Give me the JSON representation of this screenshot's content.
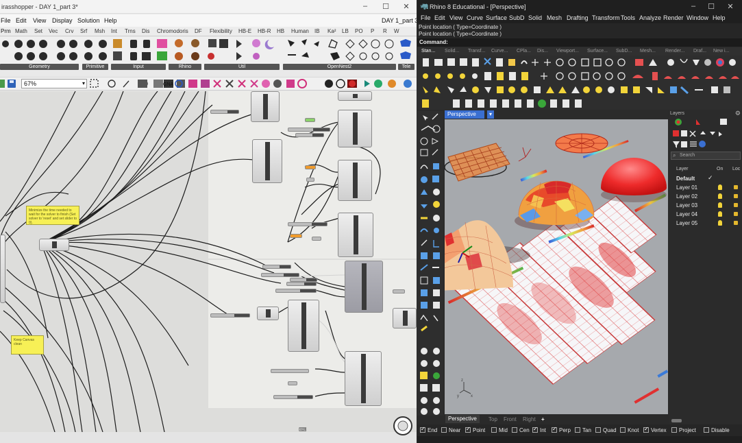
{
  "grasshopper": {
    "title": "irasshopper - DAY 1_part 3*",
    "doc_title": "DAY 1_part 3",
    "menu": [
      "File",
      "Edit",
      "View",
      "Display",
      "Solution",
      "Help"
    ],
    "tabs": [
      "Prm",
      "Math",
      "Set",
      "Vec",
      "Crv",
      "Srf",
      "Msh",
      "Int",
      "Trns",
      "Dis",
      "Chromodoris",
      "DF",
      "Flexibility",
      "HB-E",
      "HB-R",
      "HB",
      "Human",
      "IB",
      "Ka²",
      "LB",
      "PO",
      "P",
      "R",
      "W"
    ],
    "active_tab": "Prm",
    "groups": [
      "Geometry",
      "Primitive",
      "Input",
      "Rhino",
      "Util",
      "OpenNest2",
      "Tele"
    ],
    "zoom": "67%",
    "note1": "Minimize the time needed to wait for the solver to finish (Set solver to 'reset' and set slider to 0).",
    "note2": "Keep Canvas clean"
  },
  "rhino": {
    "title": "Rhino 8 Educational - [Perspective]",
    "menu": [
      "File",
      "Edit",
      "View",
      "Curve",
      "Surface",
      "SubD",
      "Solid",
      "Mesh",
      "Drafting",
      "Transform",
      "Tools",
      "Analyze",
      "Render",
      "Window",
      "Help"
    ],
    "history": [
      "Point location ( Type=Coordinate )",
      "Point location ( Type=Coordinate )"
    ],
    "command_label": "Command:",
    "toolbar_tabs": [
      "Stan...",
      "Solid...",
      "Transf...",
      "Curve...",
      "CPla...",
      "Dis...",
      "Viewport...",
      "Surface...",
      "SubD...",
      "Mesh...",
      "Render...",
      "Draf...",
      "New i..."
    ],
    "viewport_title": "Perspective",
    "viewport_tabs": [
      "Perspective",
      "Top",
      "Front",
      "Right"
    ],
    "layers_panel": {
      "title": "Layers",
      "search_placeholder": "Search",
      "col_layer": "Layer",
      "col_on": "On",
      "col_lock": "Loc",
      "rows": [
        "Default",
        "Layer 01",
        "Layer 02",
        "Layer 03",
        "Layer 04",
        "Layer 05"
      ]
    },
    "osnaps": [
      {
        "label": "End",
        "on": true
      },
      {
        "label": "Near",
        "on": false
      },
      {
        "label": "Point",
        "on": true
      },
      {
        "label": "Mid",
        "on": false
      },
      {
        "label": "Cen",
        "on": false
      },
      {
        "label": "Int",
        "on": true
      },
      {
        "label": "Perp",
        "on": true
      },
      {
        "label": "Tan",
        "on": false
      },
      {
        "label": "Quad",
        "on": false
      },
      {
        "label": "Knot",
        "on": false
      },
      {
        "label": "Vertex",
        "on": true
      },
      {
        "label": "Project",
        "on": false
      },
      {
        "label": "Disable",
        "on": false
      }
    ]
  }
}
